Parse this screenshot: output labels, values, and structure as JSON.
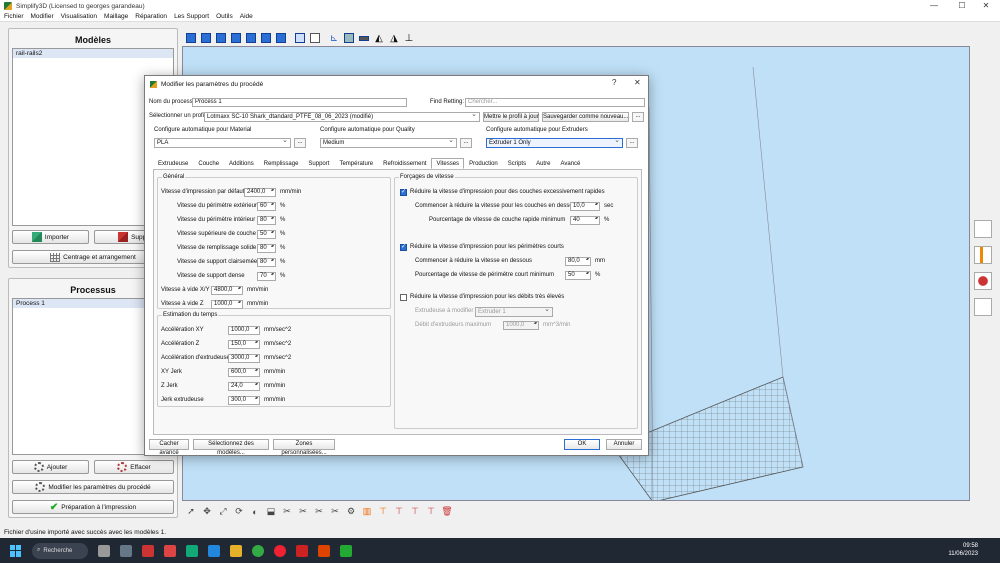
{
  "window": {
    "title": "Simplify3D (Licensed to georges garandeau)",
    "min": "—",
    "max": "☐",
    "close": "✕"
  },
  "menu": [
    "Fichier",
    "Modifier",
    "Visualisation",
    "Maillage",
    "Réparation",
    "Les Support",
    "Outils",
    "Aide"
  ],
  "models": {
    "title": "Modèles",
    "items": [
      "rail-rails2"
    ],
    "import": "Importer",
    "delete": "Suppri",
    "center": "Centrage et arrangement"
  },
  "processes": {
    "title": "Processus",
    "items": [
      "Process 1"
    ],
    "add": "Ajouter",
    "remove": "Effacer",
    "edit": "Modifier les paramètres du procédé",
    "prepare": "Préparation à l'impression"
  },
  "status": "Fichier d'usine importé avec succès avec les modèles 1.",
  "taskbar": {
    "search": "Recherche",
    "time": "09:58",
    "date": "11/06/2023"
  },
  "dialog": {
    "title": "Modifier les paramètres du procédé",
    "help": "?",
    "close": "✕",
    "process_name_label": "Nom du process",
    "process_name": "Process 1",
    "find_label": "Find Retting:",
    "find_placeholder": "Chercher...",
    "profile_label": "Sélectionner un profil",
    "profile": "Lotmaxx SC-10 Shark_dtandard_PTFE_08_06_2023 (modifié)",
    "update_profile": "Mettre le profil à jour",
    "save_new": "Sauvegarder comme nouveau...",
    "more": "...",
    "auto_material_label": "Configure automatique pour Material",
    "auto_material": "PLA",
    "auto_quality_label": "Configure automatique pour Quality",
    "auto_quality": "Medium",
    "auto_extruders_label": "Configure automatique pour Extruders",
    "auto_extruders": "Extruder 1 Only",
    "tabs": [
      "Extrudeuse",
      "Couche",
      "Additions",
      "Remplissage",
      "Support",
      "Température",
      "Refroidissement",
      "Vitesses",
      "Production",
      "Scripts",
      "Autre",
      "Avancé"
    ],
    "general": {
      "title": "Général",
      "default_speed": {
        "label": "Vitesse d'impression par défaut",
        "value": "2400,0",
        "unit": "mm/min"
      },
      "rows": [
        {
          "label": "Vitesse du périmètre extérieur",
          "value": "60",
          "unit": "%"
        },
        {
          "label": "Vitesse du périmètre intérieur",
          "value": "80",
          "unit": "%"
        },
        {
          "label": "Vitesse supérieure de couche",
          "value": "50",
          "unit": "%"
        },
        {
          "label": "Vitesse de remplissage solide",
          "value": "80",
          "unit": "%"
        },
        {
          "label": "Vitesse de support clairsemée",
          "value": "80",
          "unit": "%"
        },
        {
          "label": "Vitesse de support dense",
          "value": "70",
          "unit": "%"
        }
      ],
      "xy_travel": {
        "label": "Vitesse à vide X/Y",
        "value": "4800,0",
        "unit": "mm/min"
      },
      "z_travel": {
        "label": "Vitesse à vide Z",
        "value": "1000,0",
        "unit": "mm/min"
      }
    },
    "time_est": {
      "title": "Estimation du temps",
      "rows": [
        {
          "label": "Accélération XY",
          "value": "1000,0",
          "unit": "mm/sec^2"
        },
        {
          "label": "Accélération Z",
          "value": "150,0",
          "unit": "mm/sec^2"
        },
        {
          "label": "Accélération d'extrudeuse",
          "value": "3000,0",
          "unit": "mm/sec^2"
        },
        {
          "label": "XY Jerk",
          "value": "600,0",
          "unit": "mm/min"
        },
        {
          "label": "Z Jerk",
          "value": "24,0",
          "unit": "mm/min"
        },
        {
          "label": "Jerk extrudeuse",
          "value": "300,0",
          "unit": "mm/min"
        }
      ]
    },
    "overrides": {
      "title": "Forçages de vitesse",
      "fast_layers": {
        "label": "Réduire la vitesse d'impression pour des couches excessivement rapides",
        "r1": {
          "label": "Commencer à réduire la vitesse pour les couches en dessous",
          "value": "10,0",
          "unit": "sec"
        },
        "r2": {
          "label": "Pourcentage de vitesse de couche rapide minimum",
          "value": "40",
          "unit": "%"
        }
      },
      "short_perims": {
        "label": "Réduire la vitesse d'impression pour les périmètres courts",
        "r1": {
          "label": "Commencer à réduire la vitesse en dessous",
          "value": "80,0",
          "unit": "mm"
        },
        "r2": {
          "label": "Pourcentage de vitesse de périmètre court minimum",
          "value": "50",
          "unit": "%"
        }
      },
      "high_flow": {
        "label": "Réduire la vitesse d'impression pour les débits très élevés",
        "r1": {
          "label": "Extrudeuse à modifier",
          "value": "Extruder 1"
        },
        "r2": {
          "label": "Débit d'extrudeurs maximum",
          "value": "1000,0",
          "unit": "mm^3/min"
        }
      }
    },
    "hide_advanced": "Cacher avancé",
    "select_models": "Sélectionnez des modèles...",
    "custom_zones": "Zones personnalisées...",
    "ok": "OK",
    "cancel": "Annuler"
  }
}
